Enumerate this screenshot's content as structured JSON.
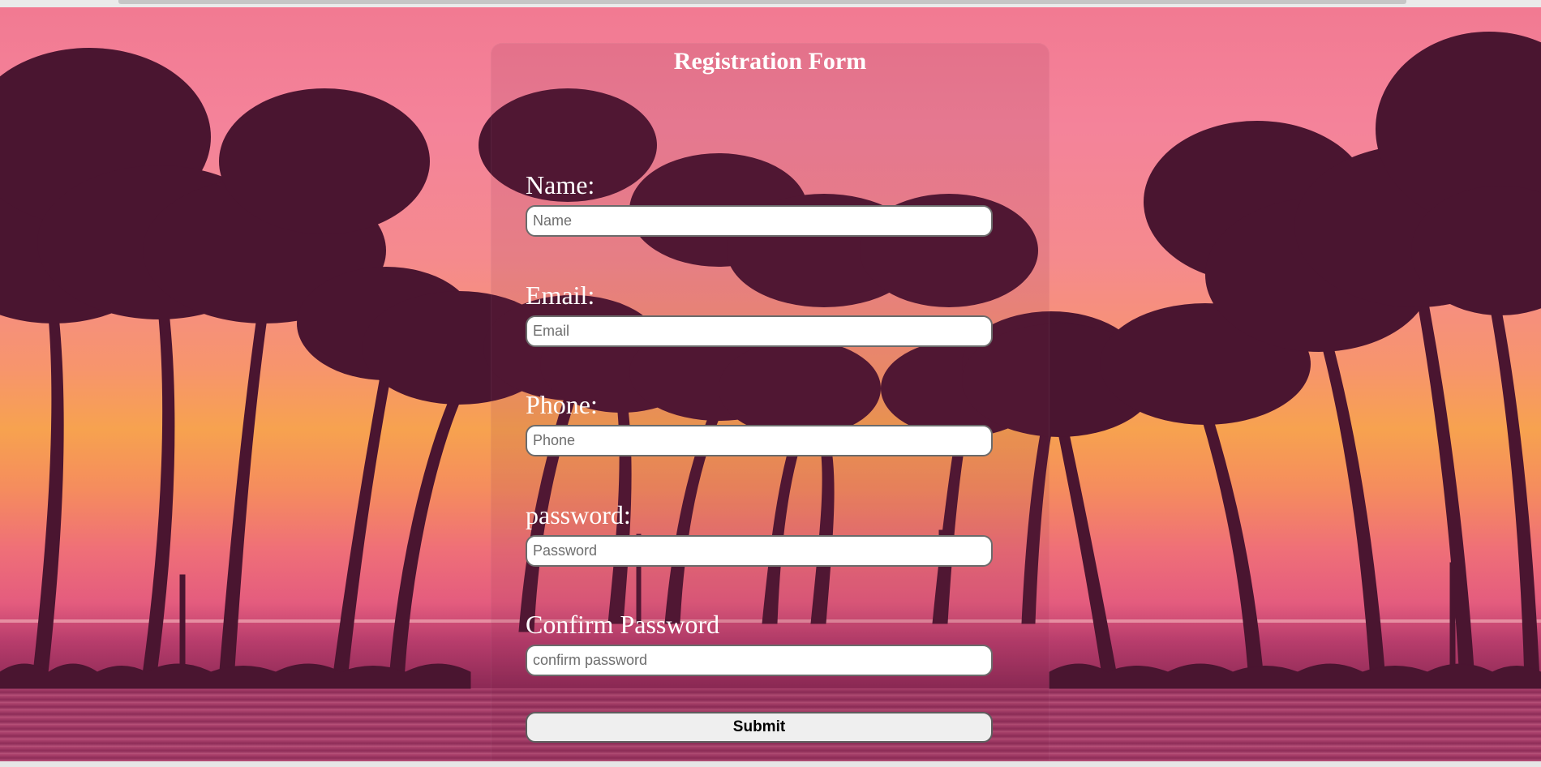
{
  "form": {
    "title": "Registration Form",
    "fields": [
      {
        "label": "Name:",
        "placeholder": "Name",
        "value": ""
      },
      {
        "label": "Email:",
        "placeholder": "Email",
        "value": ""
      },
      {
        "label": "Phone:",
        "placeholder": "Phone",
        "value": ""
      },
      {
        "label": "password:",
        "placeholder": "Password",
        "value": ""
      },
      {
        "label": "Confirm Password",
        "placeholder": "confirm password",
        "value": ""
      }
    ],
    "submit_label": "Submit"
  },
  "colors": {
    "sky_top": "#f27a92",
    "sky_glow": "#f7a24f",
    "palm_silhouette": "#4a1530",
    "label_text": "#ffffff"
  }
}
